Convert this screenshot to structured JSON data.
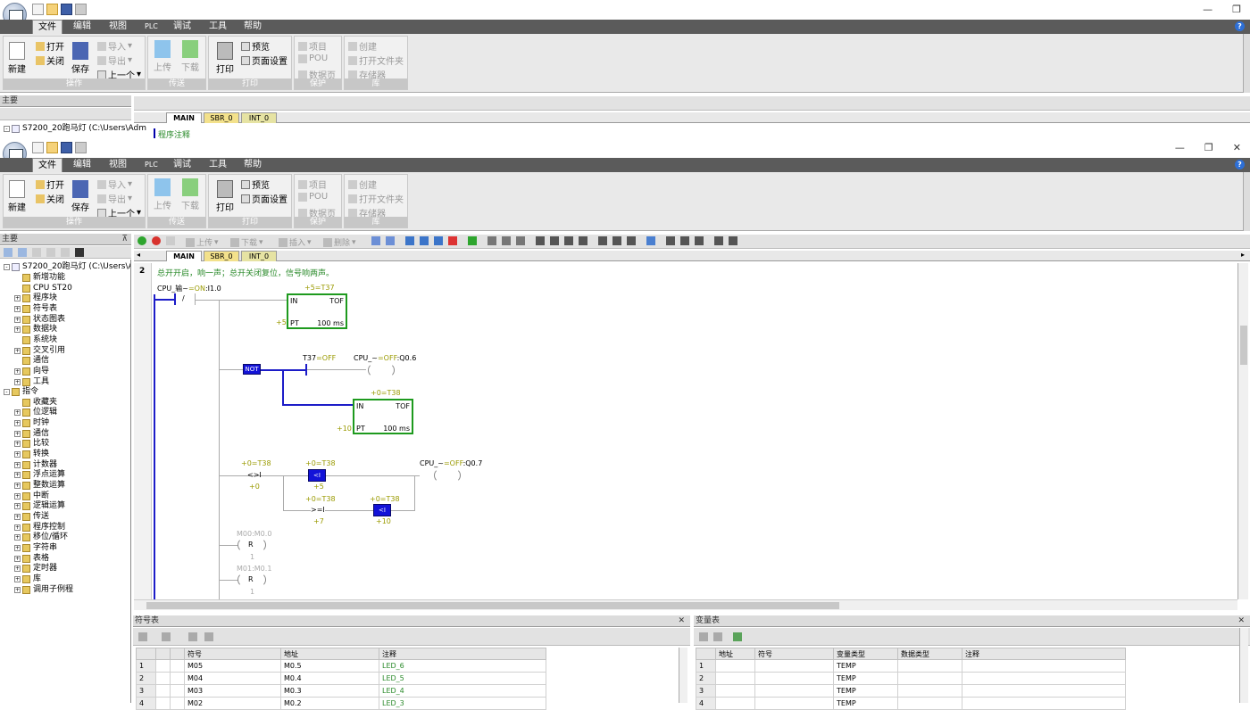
{
  "window": {
    "menu_tabs": [
      "文件",
      "编辑",
      "视图",
      "PLC",
      "调试",
      "工具",
      "帮助"
    ],
    "controls": [
      "—",
      "❐",
      "✕"
    ],
    "help": "?"
  },
  "ribbon": {
    "groups": [
      {
        "title": "操作",
        "big": [
          "新建",
          "保存"
        ],
        "small": [
          "打开",
          "关闭",
          "导入",
          "导出",
          "上一个"
        ]
      },
      {
        "title": "传送",
        "big": [
          "上传",
          "下载"
        ]
      },
      {
        "title": "打印",
        "big": [
          "打印"
        ],
        "small": [
          "预览",
          "页面设置"
        ]
      },
      {
        "title": "保护",
        "small": [
          "项目",
          "POU",
          "数据页"
        ]
      },
      {
        "title": "库",
        "small": [
          "创建",
          "打开文件夹",
          "存储器"
        ]
      }
    ]
  },
  "nav_panel": {
    "title": "主要",
    "pin": "⊼"
  },
  "editor": {
    "toolbar_items": [
      "上传",
      "下载",
      "插入",
      "删除"
    ],
    "tabs": [
      "MAIN",
      "SBR_0",
      "INT_0"
    ],
    "comment_label": "程序注释",
    "network_no": "2",
    "network_comment": "总开开启，响一声；总开关闭复位，信号响两声。"
  },
  "project_tree": {
    "root": "S7200_20跑马灯 (C:\\Users\\Adm",
    "items": [
      {
        "label": "新增功能",
        "level": 1,
        "expand": false
      },
      {
        "label": "CPU ST20",
        "level": 1,
        "expand": false
      },
      {
        "label": "程序块",
        "level": 1,
        "expand": true
      },
      {
        "label": "符号表",
        "level": 1,
        "expand": true
      },
      {
        "label": "状态图表",
        "level": 1,
        "expand": true
      },
      {
        "label": "数据块",
        "level": 1,
        "expand": true
      },
      {
        "label": "系统块",
        "level": 1,
        "expand": false
      },
      {
        "label": "交叉引用",
        "level": 1,
        "expand": true
      },
      {
        "label": "通信",
        "level": 1,
        "expand": false
      },
      {
        "label": "向导",
        "level": 1,
        "expand": true
      },
      {
        "label": "工具",
        "level": 1,
        "expand": true
      },
      {
        "label": "指令",
        "level": 0,
        "expand": true
      },
      {
        "label": "收藏夹",
        "level": 1,
        "expand": false
      },
      {
        "label": "位逻辑",
        "level": 1,
        "expand": true
      },
      {
        "label": "时钟",
        "level": 1,
        "expand": true
      },
      {
        "label": "通信",
        "level": 1,
        "expand": true
      },
      {
        "label": "比较",
        "level": 1,
        "expand": true
      },
      {
        "label": "转换",
        "level": 1,
        "expand": true
      },
      {
        "label": "计数器",
        "level": 1,
        "expand": true
      },
      {
        "label": "浮点运算",
        "level": 1,
        "expand": true
      },
      {
        "label": "整数运算",
        "level": 1,
        "expand": true
      },
      {
        "label": "中断",
        "level": 1,
        "expand": true
      },
      {
        "label": "逻辑运算",
        "level": 1,
        "expand": true
      },
      {
        "label": "传送",
        "level": 1,
        "expand": true
      },
      {
        "label": "程序控制",
        "level": 1,
        "expand": true
      },
      {
        "label": "移位/循环",
        "level": 1,
        "expand": true
      },
      {
        "label": "字符串",
        "level": 1,
        "expand": true
      },
      {
        "label": "表格",
        "level": 1,
        "expand": true
      },
      {
        "label": "定时器",
        "level": 1,
        "expand": true
      },
      {
        "label": "库",
        "level": 1,
        "expand": true
      },
      {
        "label": "调用子例程",
        "level": 1,
        "expand": true
      }
    ]
  },
  "ladder": {
    "in_contact": {
      "name": "CPU_输~",
      "state": "=ON",
      "addr": ":I1.0",
      "sym": "/"
    },
    "tof1": {
      "top": "+5=T37",
      "in": "IN",
      "type": "TOF",
      "pt": "PT",
      "pt_val": "+5",
      "unit": "100 ms"
    },
    "not": "NOT",
    "t37": {
      "name": "T37",
      "state": "=OFF"
    },
    "q06": {
      "name": "CPU_~",
      "state": "=OFF",
      "addr": ":Q0.6"
    },
    "tof2": {
      "top": "+0=T38",
      "in": "IN",
      "type": "TOF",
      "pt": "PT",
      "pt_val": "+10",
      "unit": "100 ms"
    },
    "cmp1": {
      "top": "+0=T38",
      "op": "<>I",
      "bottom": "+0"
    },
    "cmp2": {
      "top": "+0=T38",
      "op": "<I",
      "bottom": "+5"
    },
    "q07": {
      "name": "CPU_~",
      "state": "=OFF",
      "addr": ":Q0.7"
    },
    "cmp3": {
      "top": "+0=T38",
      "op": ">=I",
      "bottom": "+7"
    },
    "cmp4": {
      "top": "+0=T38",
      "op": "<I",
      "bottom": "+10"
    },
    "r1": {
      "top": "M00:M0.0",
      "op": "R",
      "bottom": "1"
    },
    "r2": {
      "top": "M01:M0.1",
      "op": "R",
      "bottom": "1"
    }
  },
  "symbol_table": {
    "title": "符号表",
    "headers": [
      "符号",
      "地址",
      "注释"
    ],
    "rows": [
      {
        "n": "1",
        "sym": "M05",
        "addr": "M0.5",
        "note": "LED_6"
      },
      {
        "n": "2",
        "sym": "M04",
        "addr": "M0.4",
        "note": "LED_5"
      },
      {
        "n": "3",
        "sym": "M03",
        "addr": "M0.3",
        "note": "LED_4"
      },
      {
        "n": "4",
        "sym": "M02",
        "addr": "M0.2",
        "note": "LED_3"
      }
    ]
  },
  "var_table": {
    "title": "变量表",
    "headers": [
      "地址",
      "符号",
      "变量类型",
      "数据类型",
      "注释"
    ],
    "rows": [
      {
        "n": "1",
        "type": "TEMP"
      },
      {
        "n": "2",
        "type": "TEMP"
      },
      {
        "n": "3",
        "type": "TEMP"
      },
      {
        "n": "4",
        "type": "TEMP"
      }
    ]
  },
  "colors": {
    "accent": "#1313d8",
    "box": "#1e9a1e",
    "menubar": "#5b5b5b"
  }
}
